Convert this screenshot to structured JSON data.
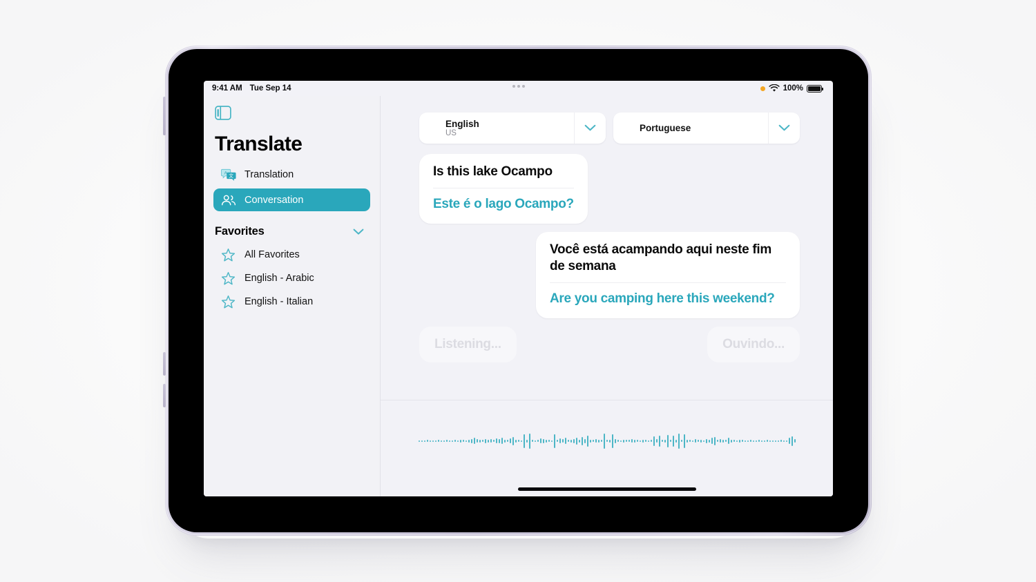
{
  "device": {
    "name": "iPad mini",
    "frame_color": "#c9c4d8",
    "bezel_color": "#000000"
  },
  "statusbar": {
    "time": "9:41 AM",
    "date": "Tue Sep 14",
    "mic_indicator": "orange-dot",
    "wifi_icon": "wifi-icon",
    "battery_percent": "100%",
    "battery_icon": "battery-full-icon",
    "multitask_handle": "three-dots-icon"
  },
  "sidebar": {
    "toggle_icon": "sidebar-toggle-icon",
    "title": "Translate",
    "nav": [
      {
        "label": "Translation",
        "icon": "translation-bubbles-icon",
        "active": false
      },
      {
        "label": "Conversation",
        "icon": "two-people-icon",
        "active": true
      }
    ],
    "section": {
      "title": "Favorites",
      "chevron_icon": "chevron-down-icon",
      "items": [
        {
          "label": "All Favorites",
          "icon": "star-icon"
        },
        {
          "label": "English - Arabic",
          "icon": "star-icon"
        },
        {
          "label": "English - Italian",
          "icon": "star-icon"
        }
      ]
    }
  },
  "main": {
    "source_language": {
      "name": "English",
      "region": "US",
      "chevron_icon": "chevron-down-icon"
    },
    "target_language": {
      "name": "Portuguese",
      "region": "",
      "chevron_icon": "chevron-down-icon"
    },
    "messages": [
      {
        "side": "left",
        "source": "Is this lake Ocampo",
        "translation": "Este é o lago Ocampo?"
      },
      {
        "side": "right",
        "source": "Você está acampando aqui neste fim de semana",
        "translation": "Are you camping here this weekend?"
      }
    ],
    "listening": {
      "left_label": "Listening...",
      "right_label": "Ouvindo..."
    },
    "waveform": {
      "icon": "audio-waveform-icon",
      "color": "#4cb6c6",
      "bars": [
        2,
        2,
        2,
        3,
        2,
        2,
        2,
        3,
        2,
        2,
        3,
        2,
        2,
        3,
        2,
        4,
        3,
        2,
        4,
        6,
        9,
        5,
        4,
        3,
        6,
        4,
        5,
        3,
        7,
        6,
        9,
        4,
        3,
        7,
        12,
        4,
        3,
        2,
        20,
        4,
        22,
        3,
        2,
        3,
        7,
        6,
        4,
        3,
        2,
        20,
        3,
        7,
        5,
        9,
        3,
        4,
        6,
        10,
        4,
        12,
        6,
        16,
        4,
        3,
        5,
        4,
        3,
        22,
        3,
        4,
        20,
        6,
        3,
        2,
        4,
        3,
        3,
        5,
        4,
        3,
        2,
        4,
        3,
        2,
        3,
        14,
        5,
        16,
        3,
        4,
        18,
        3,
        16,
        4,
        22,
        3,
        20,
        4,
        3,
        2,
        5,
        3,
        4,
        2,
        6,
        4,
        9,
        12,
        3,
        5,
        4,
        3,
        9,
        4,
        3,
        2,
        4,
        3,
        2,
        2,
        3,
        2,
        2,
        3,
        2,
        2,
        3,
        2,
        2,
        2,
        2,
        3,
        2,
        2,
        9,
        14,
        5
      ]
    }
  },
  "home_indicator": "home-indicator-bar",
  "colors": {
    "accent_teal": "#2aa7bb",
    "screen_bg": "#f2f2f7",
    "bubble_bg": "#ffffff",
    "placeholder_text": "#dcdce2"
  }
}
